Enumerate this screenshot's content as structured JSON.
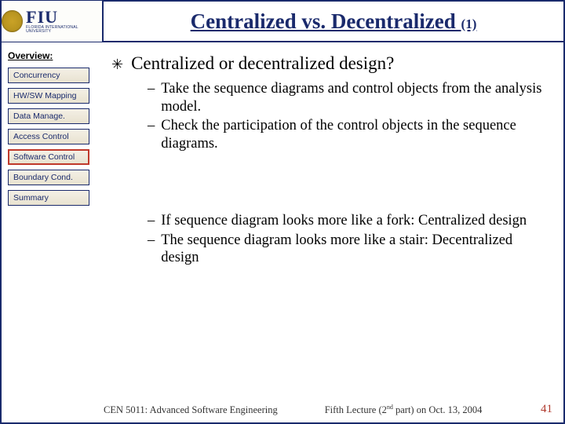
{
  "title": {
    "main": "Centralized vs. Decentralized ",
    "suffix": "(1)"
  },
  "logo": {
    "text": "FIU",
    "subtitle": "FLORIDA INTERNATIONAL UNIVERSITY"
  },
  "sidebar": {
    "heading": "Overview:",
    "items": [
      {
        "label": "Concurrency",
        "active": false
      },
      {
        "label": "HW/SW Mapping",
        "active": false
      },
      {
        "label": "Data Manage.",
        "active": false
      },
      {
        "label": "Access Control",
        "active": false
      },
      {
        "label": "Software Control",
        "active": true
      },
      {
        "label": "Boundary Cond.",
        "active": false
      },
      {
        "label": "Summary",
        "active": false
      }
    ]
  },
  "content": {
    "headline": "Centralized or decentralized design?",
    "group1": [
      "Take the sequence diagrams and control objects from the analysis model.",
      "Check the participation of the control objects in the sequence diagrams."
    ],
    "group2": [
      "If sequence diagram looks more like a fork: Centralized design",
      "The sequence diagram looks more like a stair: Decentralized design"
    ]
  },
  "footer": {
    "course": "CEN 5011: Advanced Software Engineering",
    "lecture_pre": "Fifth Lecture (2",
    "lecture_sup": "nd",
    "lecture_post": " part) on Oct. 13, 2004",
    "page": "41"
  }
}
